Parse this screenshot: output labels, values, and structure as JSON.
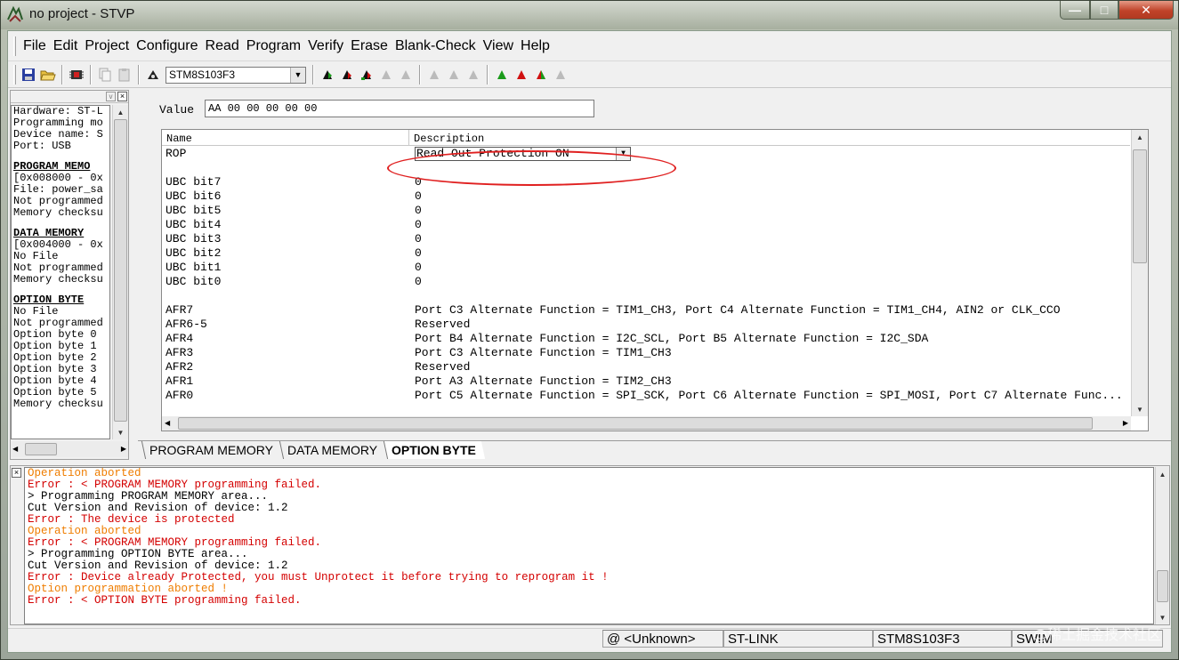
{
  "window": {
    "title": "no project - STVP",
    "buttons": {
      "minimize": "—",
      "maximize": "□",
      "close": "✕"
    }
  },
  "menubar": {
    "items": [
      {
        "label": "File"
      },
      {
        "label": "Edit"
      },
      {
        "label": "Project"
      },
      {
        "label": "Configure"
      },
      {
        "label": "Read"
      },
      {
        "label": "Program"
      },
      {
        "label": "Verify"
      },
      {
        "label": "Erase"
      },
      {
        "label": "Blank-Check"
      },
      {
        "label": "View"
      },
      {
        "label": "Help"
      }
    ]
  },
  "toolbar": {
    "device": "STM8S103F3",
    "icons": [
      "save-icon",
      "open-folder-icon",
      "chip-icon",
      "copy-icon",
      "paste-icon",
      "device-icon",
      "read-current-icon",
      "read-all-icon",
      "read-option-icon",
      "read-disabled-icon",
      "read-disabled-icon",
      "program-disabled-icon",
      "program-disabled-icon",
      "program-disabled-icon",
      "verify-icon",
      "verify-all-icon",
      "verify-option-icon",
      "verify-disabled-icon"
    ]
  },
  "info": {
    "lines_top": [
      "Hardware: ST-L",
      "Programming mo",
      "Device name: S",
      "Port: USB"
    ],
    "program_memory": {
      "header": "PROGRAM MEMO",
      "lines": [
        "[0x008000 - 0x",
        "File: power_sa",
        "Not programmed",
        "Memory checksu"
      ]
    },
    "data_memory": {
      "header": "DATA MEMORY",
      "lines": [
        "[0x004000 - 0x",
        "No File",
        "Not programmed",
        "Memory checksu"
      ]
    },
    "option_byte": {
      "header": "OPTION BYTE",
      "lines": [
        "No File",
        "Not programmed",
        "Option byte 0",
        "Option byte 1",
        "Option byte 2",
        "Option byte 3",
        "Option byte 4",
        "Option byte 5",
        "Memory checksu"
      ]
    }
  },
  "option_panel": {
    "value_label": "Value",
    "value": "AA 00 00 00 00 00",
    "columns": {
      "name": "Name",
      "description": "Description"
    },
    "rop": {
      "name": "ROP",
      "value": "Read Out Protection ON"
    },
    "ubc_rows": [
      {
        "name": "UBC bit7",
        "value": "0"
      },
      {
        "name": "UBC bit6",
        "value": "0"
      },
      {
        "name": "UBC bit5",
        "value": "0"
      },
      {
        "name": "UBC bit4",
        "value": "0"
      },
      {
        "name": "UBC bit3",
        "value": "0"
      },
      {
        "name": "UBC bit2",
        "value": "0"
      },
      {
        "name": "UBC bit1",
        "value": "0"
      },
      {
        "name": "UBC bit0",
        "value": "0"
      }
    ],
    "afr_rows": [
      {
        "name": "AFR7",
        "value": "Port C3 Alternate Function = TIM1_CH3, Port C4 Alternate Function = TIM1_CH4, AIN2 or CLK_CCO"
      },
      {
        "name": "AFR6-5",
        "value": "Reserved"
      },
      {
        "name": "AFR4",
        "value": "Port B4 Alternate Function = I2C_SCL, Port B5 Alternate Function = I2C_SDA"
      },
      {
        "name": "AFR3",
        "value": "Port C3 Alternate Function = TIM1_CH3"
      },
      {
        "name": "AFR2",
        "value": "Reserved"
      },
      {
        "name": "AFR1",
        "value": "Port A3 Alternate Function = TIM2_CH3"
      },
      {
        "name": "AFR0",
        "value": "Port C5 Alternate Function = SPI_SCK, Port C6 Alternate Function = SPI_MOSI, Port C7 Alternate Func..."
      }
    ]
  },
  "tabs": [
    {
      "label": "PROGRAM MEMORY",
      "active": false
    },
    {
      "label": "DATA MEMORY",
      "active": false
    },
    {
      "label": "OPTION BYTE",
      "active": true
    }
  ],
  "log": [
    {
      "type": "warn",
      "text": "Operation aborted"
    },
    {
      "type": "error",
      "text": "Error : < PROGRAM MEMORY programming failed."
    },
    {
      "type": "normal",
      "text": "> Programming  PROGRAM MEMORY area..."
    },
    {
      "type": "normal",
      "text": "Cut Version and Revision of device: 1.2"
    },
    {
      "type": "error",
      "text": "Error : The device is protected"
    },
    {
      "type": "warn",
      "text": "Operation aborted"
    },
    {
      "type": "error",
      "text": "Error : < PROGRAM MEMORY programming failed."
    },
    {
      "type": "normal",
      "text": "> Programming  OPTION BYTE area..."
    },
    {
      "type": "normal",
      "text": "Cut Version and Revision of device: 1.2"
    },
    {
      "type": "error",
      "text": "Error : Device already Protected, you must Unprotect it before trying to reprogram it !"
    },
    {
      "type": "warn",
      "text": "Option programmation aborted !"
    },
    {
      "type": "error",
      "text": "Error : < OPTION BYTE programming failed."
    }
  ],
  "status": {
    "address": "@ <Unknown>",
    "tool": "ST-LINK",
    "device": "STM8S103F3",
    "protocol": "SWIM"
  },
  "watermark": "@稀土掘金技术社区",
  "colors": {
    "error": "#d40000",
    "warn": "#ef7d00",
    "highlight_ring": "#e02020"
  }
}
